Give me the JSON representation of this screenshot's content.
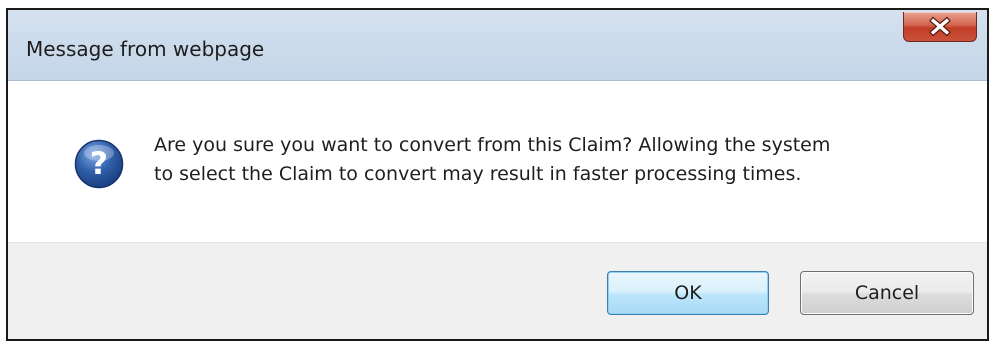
{
  "window": {
    "title": "Message from webpage",
    "close_icon": "close-x-icon"
  },
  "message": {
    "icon": "question-icon",
    "line1": "Are you sure you want to convert from this Claim? Allowing the system",
    "line2": "to select the Claim to convert may result in faster processing times."
  },
  "buttons": {
    "ok_label": "OK",
    "cancel_label": "Cancel"
  },
  "colors": {
    "titlebar": "#cddcec",
    "close_button": "#c9523a",
    "button_bar": "#f0f0f0",
    "ok_focus_border": "#3c7fb1",
    "icon_blue": "#2f5ea8"
  }
}
